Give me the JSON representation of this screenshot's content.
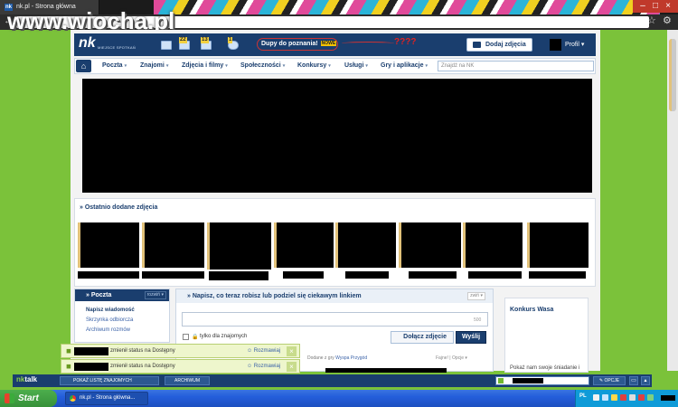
{
  "browser": {
    "tab_title": "nk.pl - Strona główna",
    "tab_favicon": "nk",
    "watermark": "www.wiocha.pl"
  },
  "header": {
    "logo": "nk",
    "logo_sub": "MIEJSCE SPOTKAŃ",
    "badges": [
      "22",
      "13",
      "1"
    ],
    "promo_text": "Dupy do poznania!",
    "promo_new": "NOWE",
    "promo_marks": "????",
    "add_photo": "Dodaj zdjęcia",
    "profile": "Profil"
  },
  "nav": {
    "items": [
      {
        "label": "Poczta"
      },
      {
        "label": "Znajomi"
      },
      {
        "label": "Zdjęcia i filmy"
      },
      {
        "label": "Społeczności"
      },
      {
        "label": "Konkursy"
      },
      {
        "label": "Usługi"
      },
      {
        "label": "Gry i aplikacje"
      }
    ],
    "search_placeholder": "Znajdź na NK"
  },
  "recent_photos": {
    "title": "Ostatnio dodane zdjęcia"
  },
  "poczta": {
    "title": "Poczta",
    "toggle": "rozwiń",
    "links": [
      "Napisz wiadomość",
      "Skrzynka odbiorcza",
      "Archiwum rozmów"
    ]
  },
  "status": {
    "title": "Napisz, co teraz robisz lub podziel się ciekawym linkiem",
    "toggle": "zwiń",
    "char_count": "500",
    "friends_only": "tylko dla znajomych",
    "attach_photo": "Dołącz zdjęcie",
    "send": "Wyślij",
    "feed_prefix": "Dodane z gry",
    "feed_game": "Wyspa Przygód",
    "feed_like": "Fajne!",
    "feed_options": "Opcje"
  },
  "konkurs": {
    "title": "Konkurs Wasa",
    "text": "Pokaż nam swoje śniadanie i"
  },
  "notifications": [
    {
      "message": "zmienił status na Dostępny",
      "action": "Rozmawiaj"
    },
    {
      "message": "zmienił status na Dostępny",
      "action": "Rozmawiaj"
    }
  ],
  "nktalk": {
    "logo_prefix": "nk",
    "logo_suffix": "talk",
    "friends_list": "POKAŻ LISTĘ ZNAJOMYCH",
    "archive": "ARCHIWUM",
    "options": "OPCJE"
  },
  "taskbar": {
    "start": "Start",
    "window": "nk.pl - Strona główna...",
    "lang": "PL"
  }
}
